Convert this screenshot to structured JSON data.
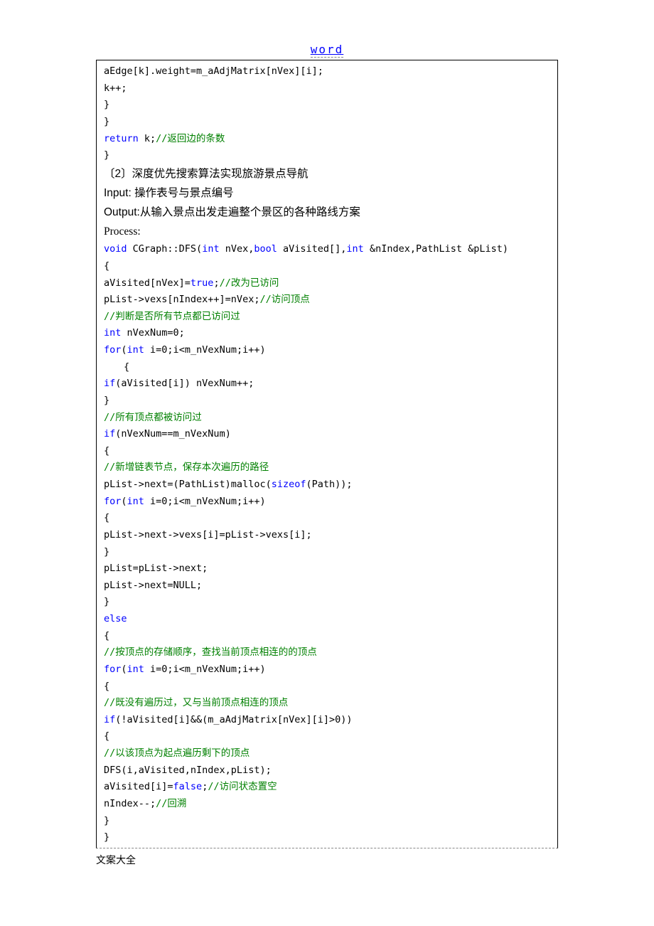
{
  "header": {
    "link": "word"
  },
  "footer": {
    "text": "文案大全"
  },
  "code": {
    "l1": "aEdge[k].weight=m_aAdjMatrix[nVex][i];",
    "l2": "k++;",
    "l3": "}",
    "l4": "}",
    "l5_kw": "return",
    "l5_txt": " k;",
    "l5_cm": "//返回边的条数",
    "l6": "}",
    "h1": "〔2〕深度优先搜索算法实现旅游景点导航",
    "h2": "Input: 操作表号与景点编号",
    "h3": "Output:从输入景点出发走遍整个景区的各种路线方案",
    "h4": "Process:",
    "l7_k1": "void",
    "l7_t1": " CGraph::DFS(",
    "l7_k2": "int",
    "l7_t2": " nVex,",
    "l7_k3": "bool",
    "l7_t3": " aVisited[],",
    "l7_k4": "int",
    "l7_t4": " &nIndex,PathList &pList)",
    "l8": "{",
    "l9_t1": "aVisited[nVex]=",
    "l9_k1": "true",
    "l9_t2": ";",
    "l9_cm": "//改为已访问",
    "l10_t1": "pList->vexs[nIndex++]=nVex;",
    "l10_cm": "//访问顶点",
    "l11_cm": "//判断是否所有节点都已访问过",
    "l12_k": "int",
    "l12_t": " nVexNum=0;",
    "l13_k1": "for",
    "l13_t1": "(",
    "l13_k2": "int",
    "l13_t2": " i=0;i<m_nVexNum;i++)",
    "l14": "{",
    "l15_k": "if",
    "l15_t": "(aVisited[i]) nVexNum++;",
    "l16": "}",
    "l17_cm": "//所有顶点都被访问过",
    "l18_k": "if",
    "l18_t": "(nVexNum==m_nVexNum)",
    "l19": "{",
    "l20_cm": "//新增链表节点，保存本次遍历的路径",
    "l21_t1": "pList->next=(PathList)malloc(",
    "l21_k": "sizeof",
    "l21_t2": "(Path));",
    "l22_k1": "for",
    "l22_t1": "(",
    "l22_k2": "int",
    "l22_t2": " i=0;i<m_nVexNum;i++)",
    "l23": "{",
    "l24": "pList->next->vexs[i]=pList->vexs[i];",
    "l25": "}",
    "l26": "pList=pList->next;",
    "l27": "pList->next=NULL;",
    "l28": "}",
    "l29_k": "else",
    "l30": "{",
    "l31_cm": "//按顶点的存储顺序，查找当前顶点相连的的顶点",
    "l32_k1": "for",
    "l32_t1": "(",
    "l32_k2": "int",
    "l32_t2": " i=0;i<m_nVexNum;i++)",
    "l33": "{",
    "l34_cm": "//既没有遍历过，又与当前顶点相连的顶点",
    "l35_k": "if",
    "l35_t": "(!aVisited[i]&&(m_aAdjMatrix[nVex][i]>0))",
    "l36": "{",
    "l37_cm": "//以该顶点为起点遍历剩下的顶点",
    "l38": "DFS(i,aVisited,nIndex,pList);",
    "l39_t1": "aVisited[i]=",
    "l39_k": "false",
    "l39_t2": ";",
    "l39_cm": "//访问状态置空",
    "l40_t": "nIndex--;",
    "l40_cm": "//回溯",
    "l41": "}",
    "l42": "}"
  }
}
